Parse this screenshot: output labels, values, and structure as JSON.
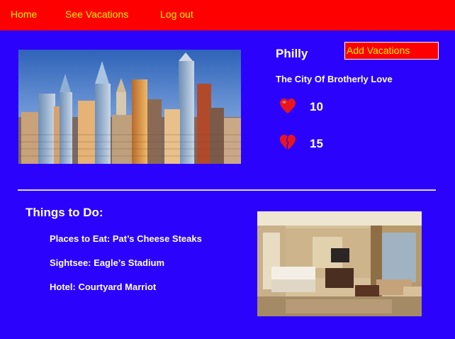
{
  "nav": {
    "home": "Home",
    "see_vacations": "See Vacations",
    "logout": "Log out"
  },
  "vacation": {
    "title": "Philly",
    "add_button": "Add Vacations",
    "tagline": "The City Of Brotherly Love",
    "likes": "10",
    "dislikes": "15"
  },
  "todo": {
    "title": "Things to Do:",
    "eat": "Places to Eat:  Pat’s Cheese Steaks",
    "sightsee": "Sightsee: Eagle’s Stadium",
    "hotel": "Hotel: Courtyard Marriot"
  },
  "colors": {
    "background": "#2b02fb",
    "nav_bar": "#fe0000",
    "nav_text": "#fff100"
  },
  "icons": {
    "like": "heart-icon",
    "dislike": "broken-heart-icon"
  }
}
